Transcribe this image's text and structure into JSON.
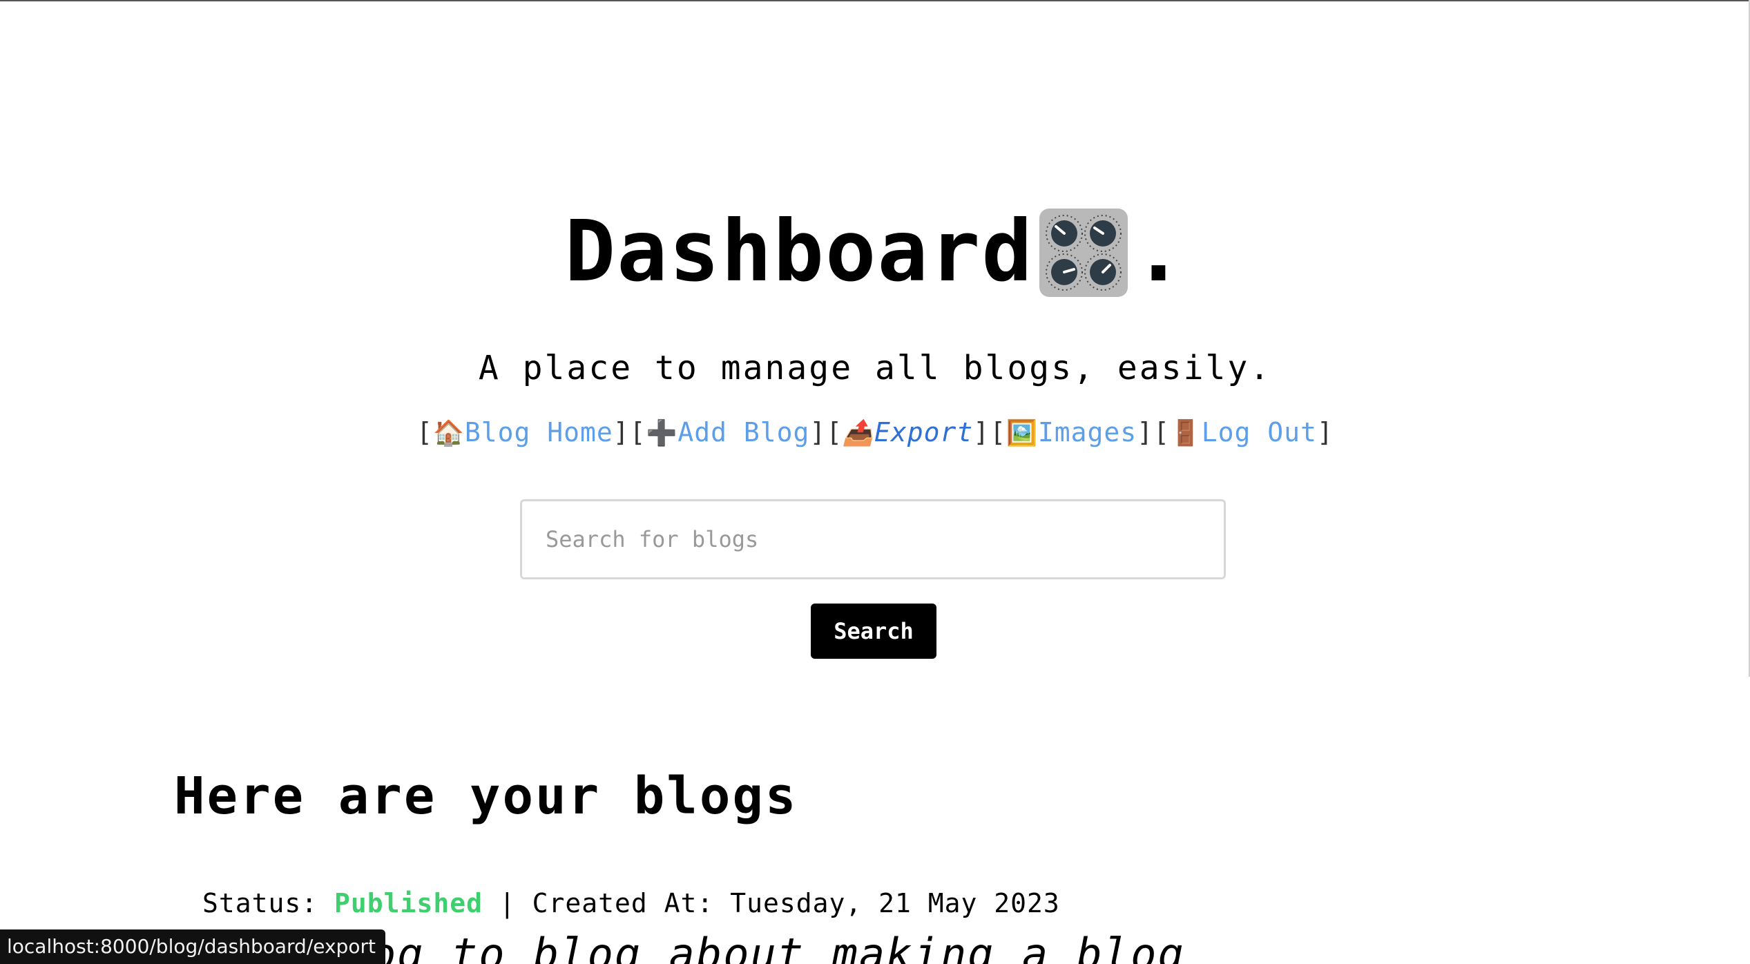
{
  "header": {
    "title": "Dashboard",
    "title_suffix": ".",
    "title_icon": "control-knobs-icon",
    "subtitle": "A place to manage all blogs, easily."
  },
  "nav": {
    "items": [
      {
        "icon": "🏠",
        "icon_name": "house-icon",
        "label": "Blog Home"
      },
      {
        "icon": "➕",
        "icon_name": "plus-icon",
        "label": "Add Blog"
      },
      {
        "icon": "📤",
        "icon_name": "outbox-tray-icon",
        "label": "Export"
      },
      {
        "icon": "🖼️",
        "icon_name": "framed-picture-icon",
        "label": "Images"
      },
      {
        "icon": "🚪",
        "icon_name": "door-icon",
        "label": "Log Out"
      }
    ],
    "bracket_open": "[",
    "bracket_close": "]"
  },
  "search": {
    "placeholder": "Search for blogs",
    "value": "",
    "button_label": "Search"
  },
  "blogs": {
    "heading": "Here are your blogs",
    "items": [
      {
        "status_label": "Status:",
        "status_value": "Published",
        "separator": "|",
        "created_label": "Created At:",
        "created_value": "Tuesday, 21 May 2023",
        "title": "e a blog to blog about making a blog"
      }
    ]
  },
  "statusbar": {
    "url": "localhost:8000/blog/dashboard/export"
  },
  "colors": {
    "link": "#5c9ee8",
    "link_active": "#2f6fd6",
    "published": "#3ecf6e",
    "button_bg": "#000000"
  }
}
